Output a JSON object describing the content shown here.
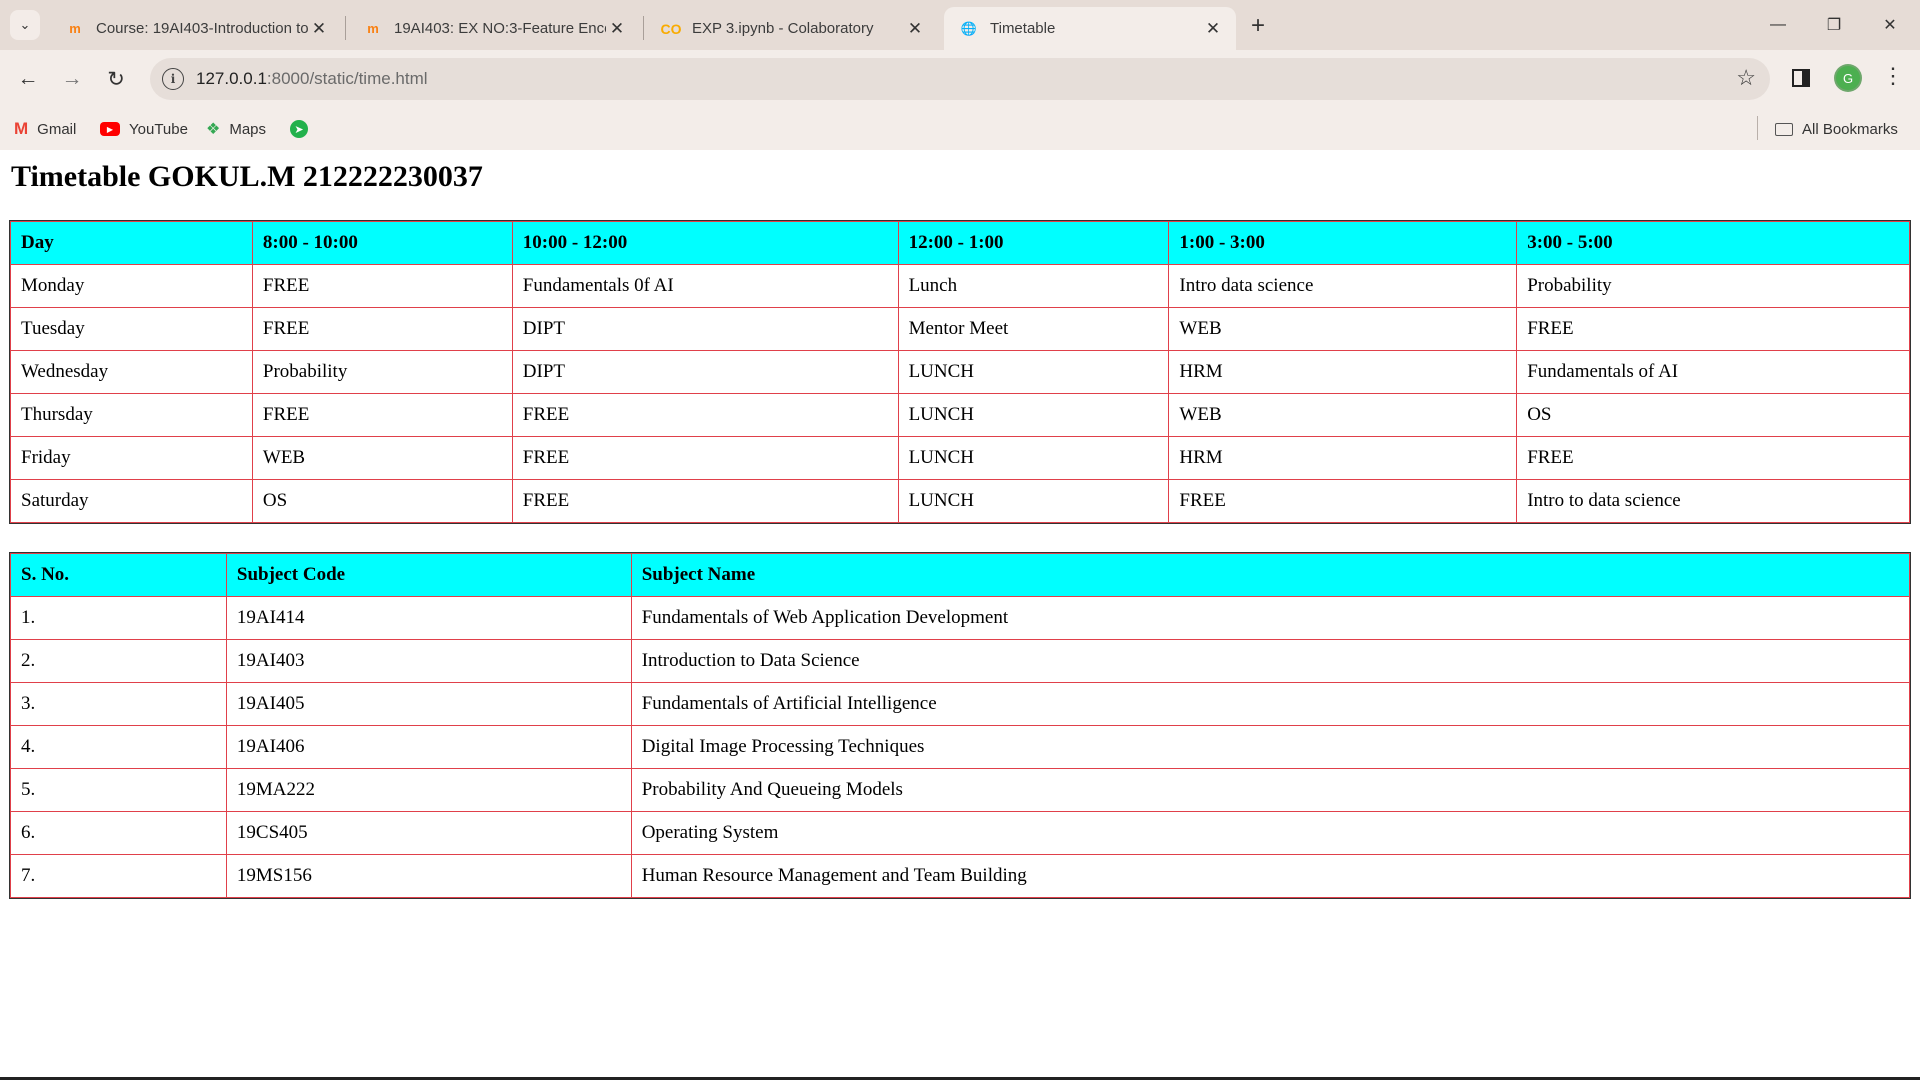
{
  "browser": {
    "tabs": [
      {
        "title": "Course: 19AI403-Introduction to",
        "favicon": "moodle-icon"
      },
      {
        "title": "19AI403: EX NO:3-Feature Enco",
        "favicon": "moodle-icon"
      },
      {
        "title": "EXP 3.ipynb - Colaboratory",
        "favicon": "colab-icon"
      },
      {
        "title": "Timetable",
        "favicon": "globe-icon"
      }
    ],
    "url_host": "127.0.0.1",
    "url_path": ":8000/static/time.html",
    "profile_initial": "G",
    "bookmarks": [
      "Gmail",
      "YouTube",
      "Maps"
    ],
    "all_bookmarks": "All Bookmarks"
  },
  "page": {
    "title": "Timetable GOKUL.M 212222230037",
    "timetable": {
      "headers": [
        "Day",
        "8:00 - 10:00",
        "10:00 - 12:00",
        "12:00 - 1:00",
        "1:00 - 3:00",
        "3:00 - 5:00"
      ],
      "rows": [
        [
          "Monday",
          "FREE",
          "Fundamentals 0f AI",
          "Lunch",
          "Intro data science",
          "Probability"
        ],
        [
          "Tuesday",
          "FREE",
          "DIPT",
          "Mentor Meet",
          "WEB",
          "FREE"
        ],
        [
          "Wednesday",
          "Probability",
          "DIPT",
          "LUNCH",
          "HRM",
          "Fundamentals of AI"
        ],
        [
          "Thursday",
          "FREE",
          "FREE",
          "LUNCH",
          "WEB",
          "OS"
        ],
        [
          "Friday",
          "WEB",
          "FREE",
          "LUNCH",
          "HRM",
          "FREE"
        ],
        [
          "Saturday",
          "OS",
          "FREE",
          "LUNCH",
          "FREE",
          "Intro to data science"
        ]
      ]
    },
    "subjects": {
      "headers": [
        "S. No.",
        "Subject Code",
        "Subject Name"
      ],
      "rows": [
        [
          "1.",
          "19AI414",
          "Fundamentals of Web Application Development"
        ],
        [
          "2.",
          "19AI403",
          "Introduction to Data Science"
        ],
        [
          "3.",
          "19AI405",
          "Fundamentals of Artificial Intelligence"
        ],
        [
          "4.",
          "19AI406",
          "Digital Image Processing Techniques"
        ],
        [
          "5.",
          "19MA222",
          "Probability And Queueing Models"
        ],
        [
          "6.",
          "19CS405",
          "Operating System"
        ],
        [
          "7.",
          "19MS156",
          "Human Resource Management and Team Building"
        ]
      ]
    }
  },
  "colors": {
    "header_bg": "#00ffff",
    "cell_border": "#e0404a",
    "chrome_bg": "#f3ede9",
    "tabstrip_bg": "#e6dcd6"
  }
}
